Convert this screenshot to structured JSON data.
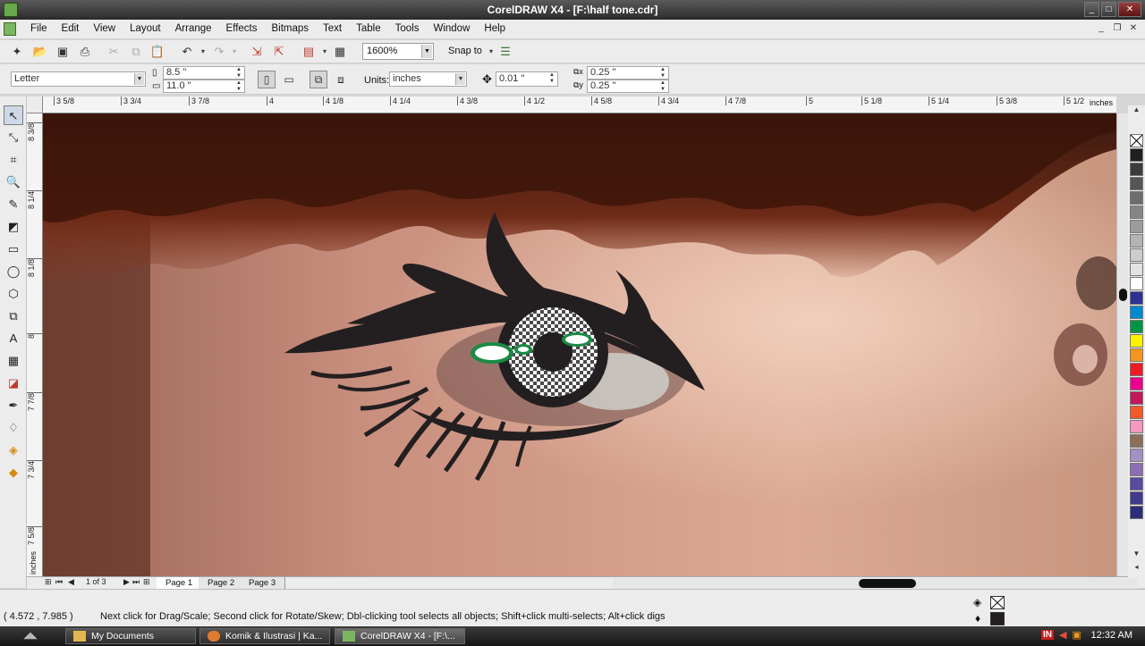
{
  "window": {
    "title": "CorelDRAW X4 - [F:\\half tone.cdr]"
  },
  "menu": [
    "File",
    "Edit",
    "View",
    "Layout",
    "Arrange",
    "Effects",
    "Bitmaps",
    "Text",
    "Table",
    "Tools",
    "Window",
    "Help"
  ],
  "toolbar": {
    "zoom": "1600%",
    "snap_to": "Snap to"
  },
  "propbar": {
    "paper": "Letter",
    "width": "8.5 \"",
    "height": "11.0 \"",
    "units_label": "Units:",
    "units": "inches",
    "nudge": "0.01 \"",
    "dup_x": "0.25 \"",
    "dup_y": "0.25 \""
  },
  "ruler_h": {
    "ticks": [
      "3 5/8",
      "3 3/4",
      "3 7/8",
      "4",
      "4 1/8",
      "4 1/4",
      "4 3/8",
      "4 1/2",
      "4 5/8",
      "4 3/4",
      "4 7/8",
      "5",
      "5 1/8",
      "5 1/4",
      "5 3/8",
      "5 1/2"
    ],
    "unit": "inches"
  },
  "ruler_v": {
    "ticks": [
      "8 3/8",
      "8 1/4",
      "8 1/8",
      "8",
      "7 7/8",
      "7 3/4",
      "7 5/8"
    ],
    "unit": "inches"
  },
  "pages": {
    "counter": "1 of 3",
    "tabs": [
      "Page 1",
      "Page 2",
      "Page 3"
    ]
  },
  "status": {
    "coords": "( 4.572 , 7.985 )",
    "hint": "Next click for Drag/Scale; Second click for Rotate/Skew; Dbl-clicking tool selects all objects; Shift+click multi-selects; Alt+click digs"
  },
  "taskbar": {
    "tasks": [
      "My Documents",
      "Komik & Ilustrasi | Ka...",
      "CorelDRAW X4 - [F:\\..."
    ],
    "lang": "IN",
    "time": "12:32 AM"
  },
  "palette": [
    "#231f20",
    "#3c3c3c",
    "#555555",
    "#6d6d6d",
    "#858585",
    "#9c9c9c",
    "#b4b4b4",
    "#cccccc",
    "#e3e3e3",
    "#ffffff",
    "#2e3192",
    "#0089d0",
    "#009444",
    "#fff200",
    "#f7941d",
    "#ed1c24",
    "#ec008c",
    "#c2185b",
    "#f15a29",
    "#f49ac1",
    "#8b6f5a",
    "#a491c4",
    "#8a6fb3",
    "#5b4a9e",
    "#3f3a8c",
    "#2b2f7a"
  ]
}
